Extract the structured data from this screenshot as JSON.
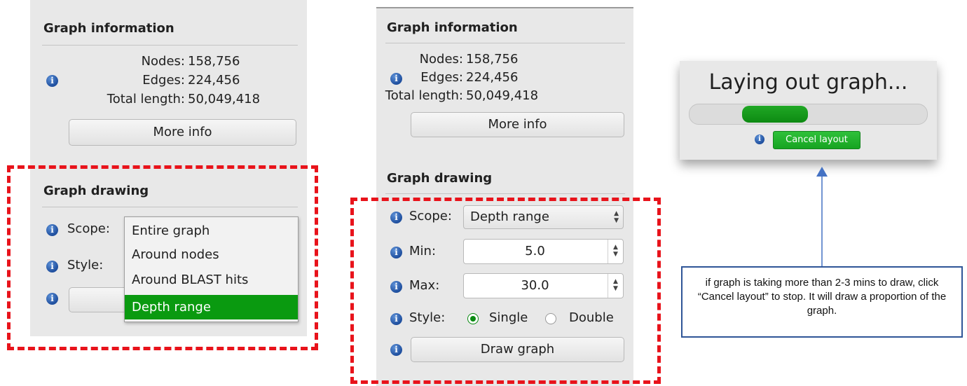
{
  "left_panel": {
    "info_heading": "Graph information",
    "stats": [
      {
        "label": "Nodes:",
        "value": "158,756"
      },
      {
        "label": "Edges:",
        "value": "224,456"
      },
      {
        "label": "Total length:",
        "value": "50,049,418"
      }
    ],
    "more_info": "More info",
    "drawing_heading": "Graph drawing",
    "scope_label": "Scope:",
    "style_label": "Style:",
    "dropdown_options": [
      "Entire graph",
      "Around nodes",
      "Around BLAST hits",
      "Depth range"
    ],
    "dropdown_selected": "Depth range"
  },
  "middle_panel": {
    "info_heading": "Graph information",
    "stats": [
      {
        "label": "Nodes:",
        "value": "158,756"
      },
      {
        "label": "Edges:",
        "value": "224,456"
      },
      {
        "label": "Total length:",
        "value": "50,049,418"
      }
    ],
    "more_info": "More info",
    "drawing_heading": "Graph drawing",
    "scope_label": "Scope:",
    "scope_value": "Depth range",
    "min_label": "Min:",
    "min_value": "5.0",
    "max_label": "Max:",
    "max_value": "30.0",
    "style_label": "Style:",
    "style_options": [
      "Single",
      "Double"
    ],
    "style_selected": "Single",
    "draw_button": "Draw graph"
  },
  "dialog": {
    "title": "Laying out graph...",
    "progress": 0.28,
    "cancel_button": "Cancel layout"
  },
  "annotation": {
    "text": "if graph is taking more than 2-3 mins to draw, click “Cancel layout” to stop. It will draw a proportion of the graph."
  },
  "colors": {
    "highlight_dash": "#e8131b",
    "selection_green": "#0a9a10",
    "note_border": "#2f5597",
    "arrow": "#4472c4"
  }
}
